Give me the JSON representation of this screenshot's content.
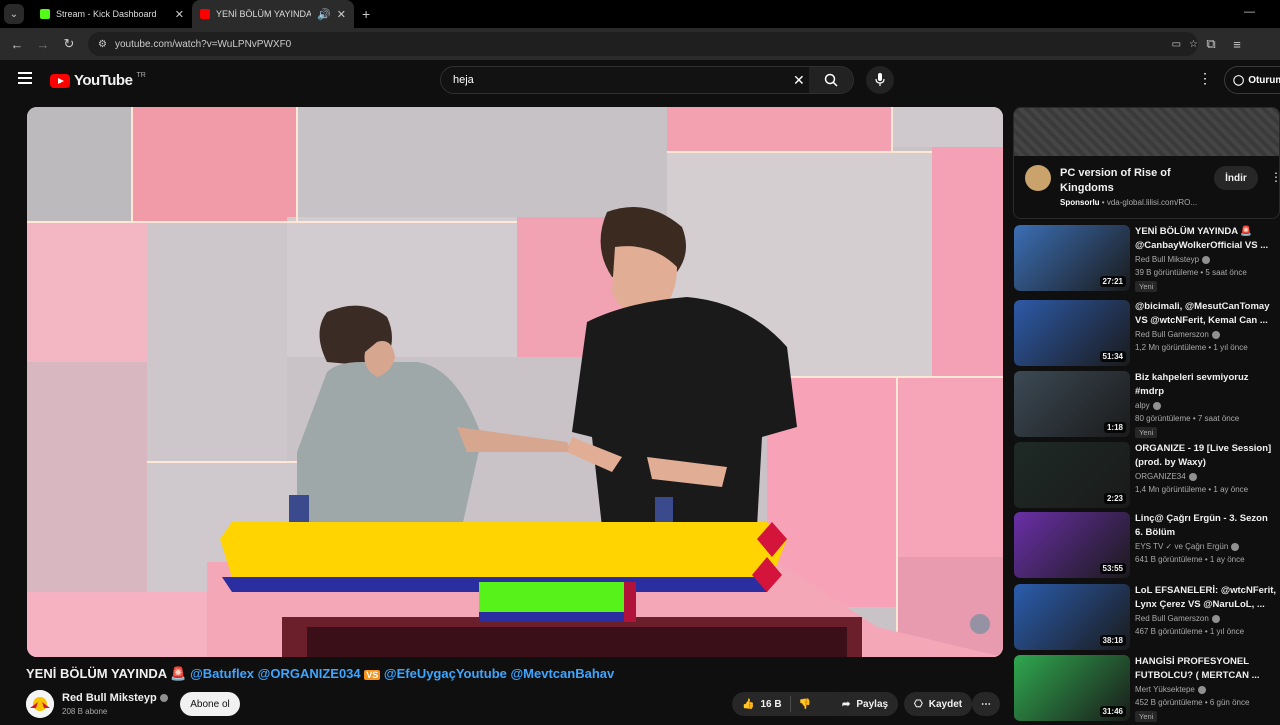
{
  "browser": {
    "tabs": [
      {
        "title": "Stream - Kick Dashboard",
        "color": "#53fc18"
      },
      {
        "title": "YENİ BÖLÜM YAYINDA 🚨 @",
        "color": "#ff0000"
      }
    ],
    "url": "youtube.com/watch?v=WuLPNvPWXF0"
  },
  "header": {
    "logo_text": "YouTube",
    "country": "TR",
    "search_value": "heja",
    "signin_label": "Oturum"
  },
  "video": {
    "title_prefix": "YENİ BÖLÜM YAYINDA 🚨",
    "mention1": "@Batuflex",
    "mention2": "@ORGANIZE034",
    "vs": "VS",
    "mention3": "@EfeUygaçYoutube",
    "mention4": "@MevtcanBahav",
    "channel": "Red Bull Miksteyp",
    "subscribers": "208 B abone",
    "subscribe_label": "Abone ol",
    "likes": "16 B",
    "share_label": "Paylaş",
    "save_label": "Kaydet"
  },
  "ad": {
    "title": "PC version of Rise of Kingdoms",
    "sponsored": "Sponsorlu",
    "domain": "vda-global.lilisi.com/RO...",
    "cta": "İndir"
  },
  "recommendations": [
    {
      "title": "YENİ BÖLÜM YAYINDA 🚨 @CanbayWolkerOfficial VS ...",
      "channel": "Red Bull Miksteyp",
      "views": "39 B görüntüleme • 5 saat önce",
      "badge": "Yeni",
      "duration": "27:21",
      "thumb": "#3b6fb5"
    },
    {
      "title": "@bicimali, @MesutCanTomay VS @wtcNFerit, Kemal Can ...",
      "channel": "Red Bull Gamerszon",
      "views": "1,2 Mn görüntüleme • 1 yıl önce",
      "badge": "",
      "duration": "51:34",
      "thumb": "#2d5aa8"
    },
    {
      "title": "Biz kahpeleri sevmiyoruz #mdrp",
      "channel": "alpy",
      "views": "80 görüntüleme • 7 saat önce",
      "badge": "Yeni",
      "duration": "1:18",
      "thumb": "#3c4a55"
    },
    {
      "title": "ORGANIZE - 19 [Live Session] (prod. by Waxy)",
      "channel": "ORGANIZE34",
      "views": "1,4 Mn görüntüleme • 1 ay önce",
      "badge": "",
      "duration": "2:23",
      "thumb": "#1e2a26"
    },
    {
      "title": "Linç@ Çağrı Ergün - 3. Sezon 6. Bölüm",
      "channel": "EYS TV ✓ ve Çağrı Ergün",
      "views": "641 B görüntüleme • 1 ay önce",
      "badge": "",
      "duration": "53:55",
      "thumb": "#6a2fa8"
    },
    {
      "title": "LoL EFSANELERİ: @wtcNFerit, Lynx Çerez VS @NaruLoL, ...",
      "channel": "Red Bull Gamerszon",
      "views": "467 B görüntüleme • 1 yıl önce",
      "badge": "",
      "duration": "38:18",
      "thumb": "#2b5dae"
    },
    {
      "title": "HANGİSİ PROFESYONEL FUTBOLCU? ( MERTCAN ...",
      "channel": "Mert Yüksektepe",
      "views": "452 B görüntüleme • 6 gün önce",
      "badge": "Yeni",
      "duration": "31:46",
      "thumb": "#2fa84f"
    }
  ]
}
